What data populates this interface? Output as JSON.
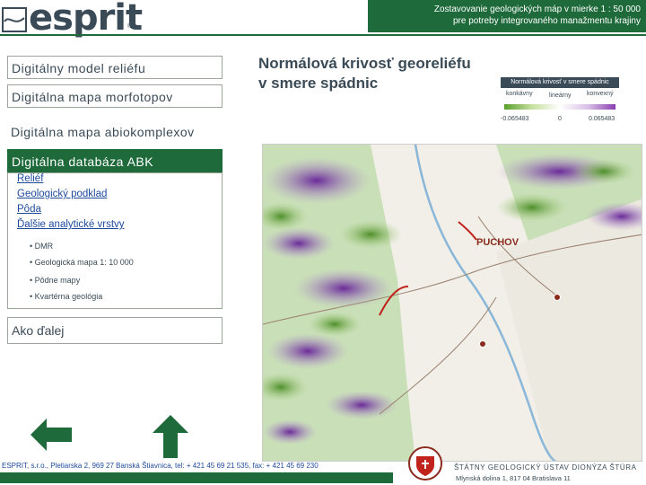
{
  "header": {
    "logo_text": "esprit",
    "logo_mark": "®",
    "title_line1": "Zostavovanie geologických máp v mierke 1 : 50 000",
    "title_line2": "pre potreby integrovaného manažmentu krajiny"
  },
  "sidebar": {
    "items": [
      {
        "label": "Digitálny model reliéfu"
      },
      {
        "label": "Digitálna mapa morfotopov"
      },
      {
        "label": "Digitálna mapa abiokomplexov"
      },
      {
        "label": "Digitálna databáza ABK"
      }
    ],
    "sub_links": [
      {
        "label": "Reliéf"
      },
      {
        "label": "Geologický podklad"
      },
      {
        "label": "Pôda"
      },
      {
        "label": "Ďalšie analytické vrstvy"
      }
    ],
    "bullets": [
      {
        "label": "DMR"
      },
      {
        "label": "Geologická mapa 1: 10 000"
      },
      {
        "label": "Pôdne mapy"
      },
      {
        "label": "Kvartérna geológia"
      }
    ],
    "next_label": "Ako ďalej"
  },
  "main": {
    "map_title": "Normálová krivosť georeliéfu v smere spádnic",
    "map_place_label": "PUCHOV",
    "legend": {
      "title": "Normálová krivosť v smere spádnic",
      "left_label": "konkávny",
      "mid_label": "lineárny",
      "right_label": "konvexný",
      "min_value": "-0.065483",
      "mid_value": "0",
      "max_value": "0.065483"
    }
  },
  "footer": {
    "contact": "ESPRIT, s.r.o., Pletiarska 2, 969 27 Banská Štiavnica, tel: + 421 45 69 21 535, fax: + 421 45 69 230",
    "org_name": "ŠTÁTNY GEOLOGICKÝ ÚSTAV DIONÝZA ŠTÚRA",
    "org_address": "Mlynská dolina 1, 817 04 Bratislava 11"
  },
  "icons": {
    "back": "arrow-left-icon",
    "up": "arrow-up-icon",
    "logo": "esprit-logo-icon",
    "emblem": "sgudš-emblem-icon"
  },
  "colors": {
    "brand_green": "#1e6a3a",
    "text_dark": "#3a4b57",
    "link_blue": "#1e4a9c"
  }
}
